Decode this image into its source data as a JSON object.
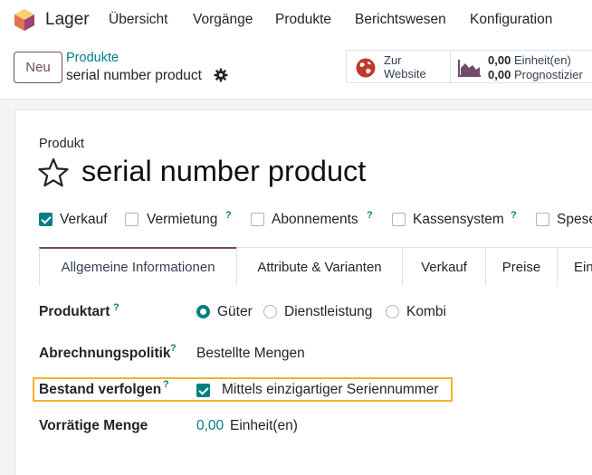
{
  "app": {
    "name": "Lager",
    "brand_color": "#714b67",
    "accent_color": "#017e84"
  },
  "menu": [
    "Übersicht",
    "Vorgänge",
    "Produkte",
    "Berichtswesen",
    "Konfiguration"
  ],
  "control": {
    "new_label": "Neu",
    "breadcrumb_parent": "Produkte",
    "breadcrumb_current": "serial number product",
    "website_line1": "Zur",
    "website_line2": "Website",
    "onhand_value": "0,00",
    "onhand_unit": "Einheit(en)",
    "forecast_value": "0,00",
    "forecast_label": "Prognostizier"
  },
  "form": {
    "product_label": "Produkt",
    "product_name": "serial number product",
    "checkboxes": [
      {
        "label": "Verkauf",
        "checked": true,
        "help": false
      },
      {
        "label": "Vermietung",
        "checked": false,
        "help": true
      },
      {
        "label": "Abonnements",
        "checked": false,
        "help": true
      },
      {
        "label": "Kassensystem",
        "checked": false,
        "help": true
      },
      {
        "label": "Spese",
        "checked": false,
        "help": false
      }
    ],
    "help_mark": "?",
    "tabs": [
      "Allgemeine Informationen",
      "Attribute & Varianten",
      "Verkauf",
      "Preise",
      "Ein"
    ],
    "active_tab": "Allgemeine Informationen",
    "fields": {
      "produktart_label": "Produktart",
      "produktart_options": [
        "Güter",
        "Dienstleistung",
        "Kombi"
      ],
      "produktart_selected": "Güter",
      "abrechnung_label": "Abrechnungspolitik",
      "abrechnung_value": "Bestellte Mengen",
      "bestand_label": "Bestand verfolgen",
      "bestand_value": "Mittels einzigartiger Seriennummer",
      "vorrat_label": "Vorrätige Menge",
      "vorrat_value": "0,00",
      "vorrat_unit": "Einheit(en)"
    }
  },
  "icons": [
    "app-logo-icon",
    "gear-icon",
    "globe-icon",
    "forecast-chart-icon",
    "favorite-star-icon"
  ]
}
